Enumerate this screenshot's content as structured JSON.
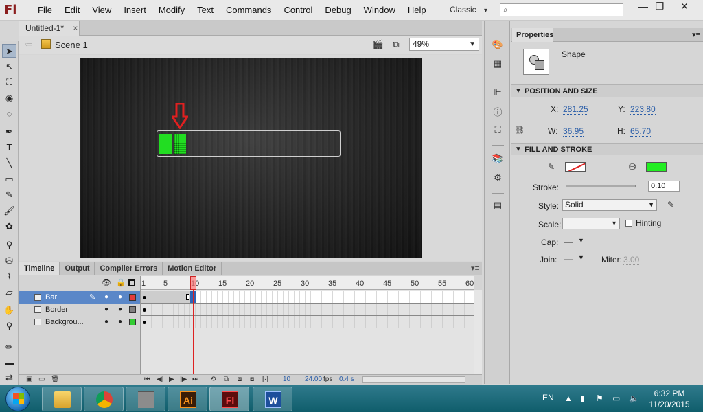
{
  "app": {
    "logo": "Fl",
    "workspace": "Classic",
    "workspace_arrow": "▾"
  },
  "menus": [
    "File",
    "Edit",
    "View",
    "Insert",
    "Modify",
    "Text",
    "Commands",
    "Control",
    "Debug",
    "Window",
    "Help"
  ],
  "window_controls": {
    "minimize": "—",
    "restore": "❐",
    "close": "✕"
  },
  "search": {
    "placeholder": "",
    "icon": "⌕"
  },
  "document": {
    "tab": "Untitled-1*",
    "close": "×"
  },
  "editbar": {
    "back": "⇦",
    "scene": "Scene 1",
    "zoom": "49%"
  },
  "stage": {
    "background_color": "#1c1c1c",
    "bar_color": "#22dd22",
    "bar_fill_fraction": 0.15
  },
  "timeline": {
    "tabs": [
      "Timeline",
      "Output",
      "Compiler Errors",
      "Motion Editor"
    ],
    "panel_menu": "▾≡",
    "ruler": [
      "1",
      "5",
      "10",
      "15",
      "20",
      "25",
      "30",
      "35",
      "40",
      "45",
      "50",
      "55",
      "60"
    ],
    "layers": [
      {
        "name": "Bar",
        "color": "#e33b3b",
        "selected": true
      },
      {
        "name": "Border",
        "color": "#808080",
        "selected": false
      },
      {
        "name": "Backgrou...",
        "color": "#33cc33",
        "selected": false
      }
    ],
    "current_frame": "10",
    "fps": "24.00",
    "fps_unit": "fps",
    "time": "0.4 s"
  },
  "properties": {
    "tab": "Properties",
    "panel_menu": "▾≡",
    "object_type": "Shape",
    "position_section": "POSITION AND SIZE",
    "x_label": "X:",
    "x": "281.25",
    "y_label": "Y:",
    "y": "223.80",
    "w_label": "W:",
    "w": "36.95",
    "h_label": "H:",
    "h": "65.70",
    "fill_section": "FILL AND STROKE",
    "stroke_label": "Stroke:",
    "stroke_value": "0.10",
    "style_label": "Style:",
    "style_value": "Solid",
    "scale_label": "Scale:",
    "scale_value": "",
    "hinting_label": "Hinting",
    "cap_label": "Cap:",
    "cap_value": "—",
    "join_label": "Join:",
    "join_value": "—",
    "miter_label": "Miter:",
    "miter_value": "3.00",
    "fill_color": "#22ee22"
  },
  "taskbar": {
    "apps": [
      {
        "name": "file-explorer",
        "label": ""
      },
      {
        "name": "chrome",
        "label": ""
      },
      {
        "name": "app-wall",
        "label": ""
      },
      {
        "name": "illustrator",
        "label": "Ai"
      },
      {
        "name": "flash",
        "label": "Fl"
      },
      {
        "name": "word",
        "label": "W"
      }
    ],
    "lang": "EN",
    "time": "6:32 PM",
    "date": "11/20/2015"
  }
}
